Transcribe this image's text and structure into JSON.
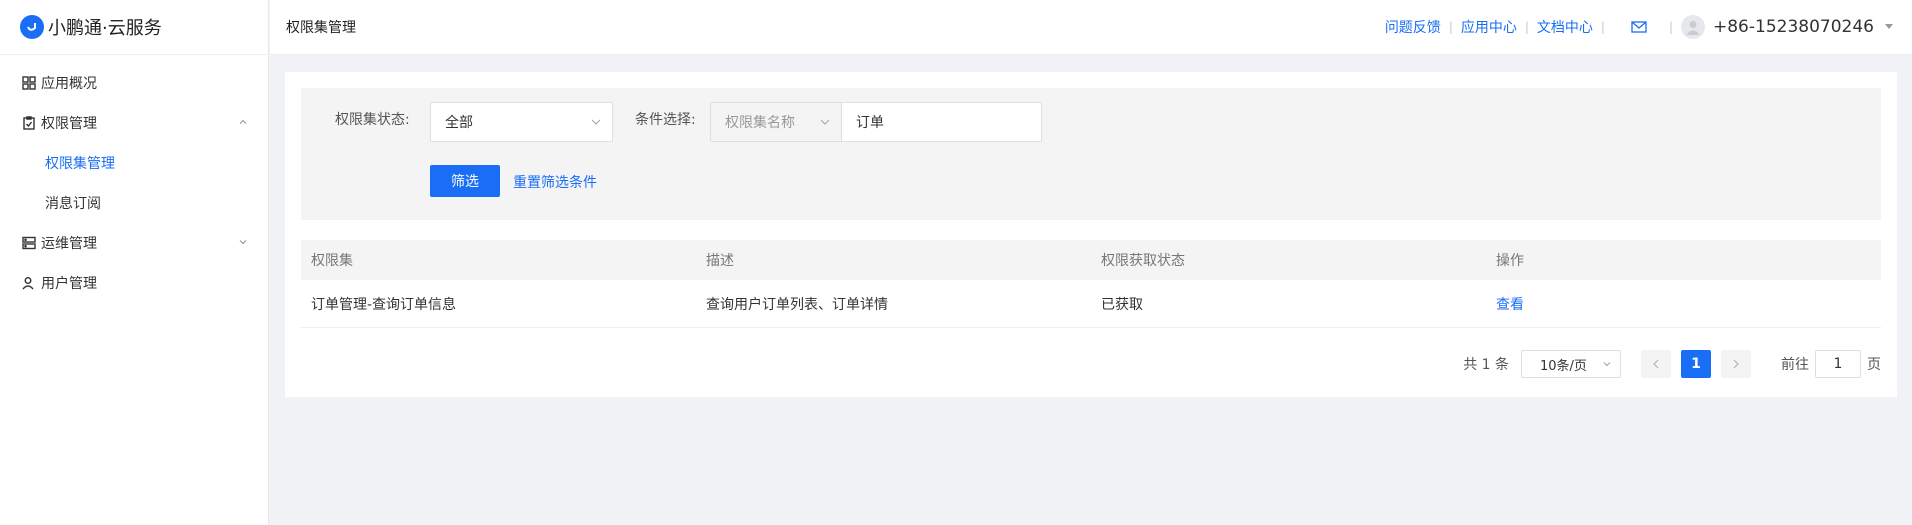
{
  "app": {
    "name": "小鹏通·云服务"
  },
  "header": {
    "title": "权限集管理",
    "links": [
      "问题反馈",
      "应用中心",
      "文档中心"
    ],
    "user": "+86-15238070246"
  },
  "sidebar": {
    "items": [
      {
        "label": "应用概况"
      },
      {
        "label": "权限管理",
        "expanded": true,
        "children": [
          {
            "label": "权限集管理",
            "active": true
          },
          {
            "label": "消息订阅"
          }
        ]
      },
      {
        "label": "运维管理",
        "expanded": false
      },
      {
        "label": "用户管理"
      }
    ]
  },
  "filter": {
    "status_label": "权限集状态:",
    "status_value": "全部",
    "condition_label": "条件选择:",
    "condition_field": "权限集名称",
    "condition_value": "订单",
    "submit_label": "筛选",
    "reset_label": "重置筛选条件"
  },
  "table": {
    "headers": [
      "权限集",
      "描述",
      "权限获取状态",
      "操作"
    ],
    "rows": [
      {
        "name": "订单管理-查询订单信息",
        "desc": "查询用户订单列表、订单详情",
        "status": "已获取",
        "action": "查看"
      }
    ]
  },
  "pagination": {
    "total_text": "共 1 条",
    "page_size": "10条/页",
    "current_page": "1",
    "goto_label": "前往",
    "goto_value": "1",
    "page_unit": "页"
  },
  "colors": {
    "accent": "#1a6ef5"
  }
}
